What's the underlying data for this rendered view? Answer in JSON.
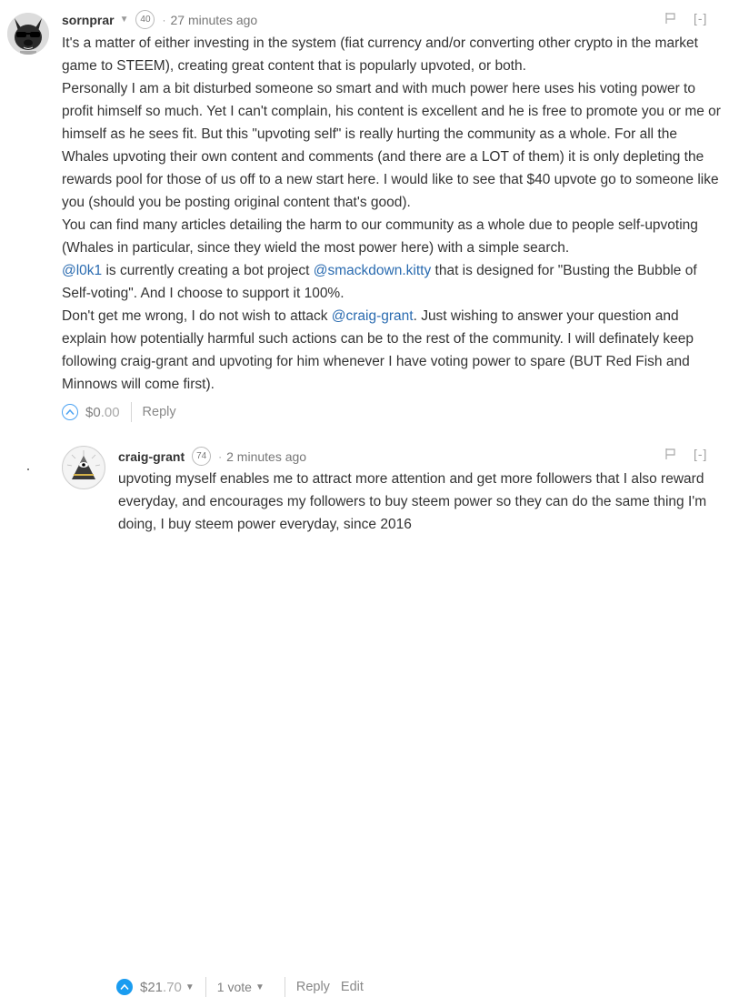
{
  "comment1": {
    "author": "sornprar",
    "reputation": "40",
    "separator": "·",
    "time": "27 minutes ago",
    "collapse": "[-]",
    "body": {
      "p1": "It's a matter of either investing in the system (fiat currency and/or converting other crypto in the market game to STEEM), creating great content that is popularly upvoted, or both.",
      "p2": "Personally I am a bit disturbed someone so smart and with much power here uses his voting power to profit himself so much. Yet I can't complain, his content is excellent and he is free to promote you or me or himself as he sees fit. But this \"upvoting self\" is really hurting the community as a whole. For all the Whales upvoting their own content and comments (and there are a LOT of them) it is only depleting the rewards pool for those of us off to a new start here. I would like to see that $40 upvote go to someone like you (should you be posting original content that's good).",
      "p3": "You can find many articles detailing the harm to our community as a whole due to people self-upvoting (Whales in particular, since they wield the most power here) with a simple search.",
      "p4_mention1": "@l0k1",
      "p4_mid": " is currently creating a bot project ",
      "p4_mention2": "@smackdown.kitty",
      "p4_end": " that is designed for \"Busting the Bubble of Self-voting\". And I choose to support it 100%.",
      "p5_start": "Don't get me wrong, I do not wish to attack ",
      "p5_mention": "@craig-grant",
      "p5_end": ". Just wishing to answer your question and explain how potentially harmful such actions can be to the rest of the community. I will definately keep following craig-grant and upvoting for him whenever I have voting power to spare (BUT Red Fish and Minnows will come first)."
    },
    "payout_dollars": "$0",
    "payout_cents": ".00",
    "reply": "Reply"
  },
  "comment2": {
    "author": "craig-grant",
    "reputation": "74",
    "separator": "·",
    "time": "2 minutes ago",
    "collapse": "[-]",
    "body": "upvoting myself enables me to attract more attention and get more followers that I also reward everyday, and encourages my followers to buy steem power so they can do the same thing I'm doing, I buy steem power everyday, since 2016",
    "payout_dollars": "$21",
    "payout_cents": ".70",
    "votes": "1 vote",
    "reply": "Reply",
    "edit": "Edit"
  },
  "colors": {
    "mention": "#2a6bb0",
    "vote_active": "#1a9cf0",
    "vote_outline": "#4ba2f2"
  },
  "icons": [
    "avatar-dog",
    "avatar-pyramid-eye",
    "dropdown-caret-icon",
    "flag-icon",
    "upvote-icon"
  ]
}
